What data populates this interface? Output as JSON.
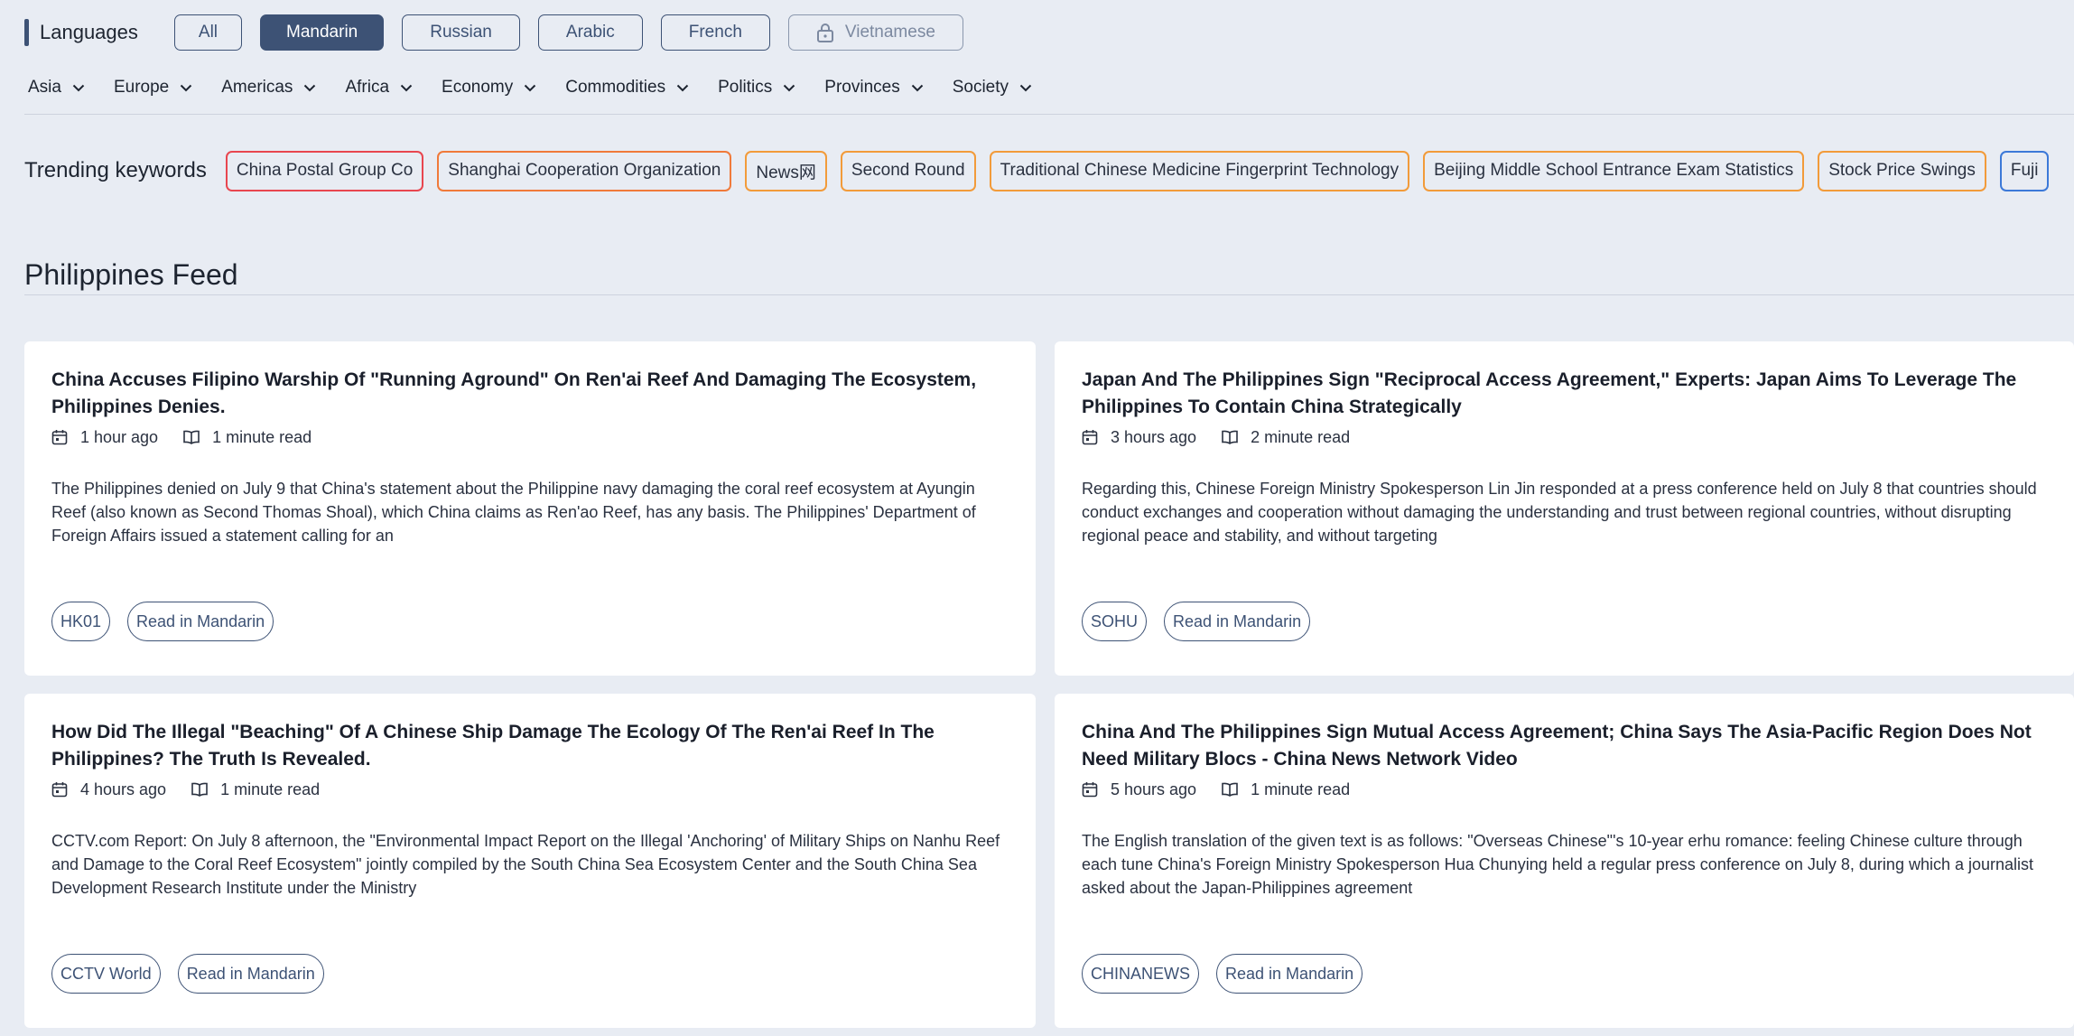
{
  "languages": {
    "title": "Languages",
    "options": [
      "All",
      "Mandarin",
      "Russian",
      "Arabic",
      "French",
      "Vietnamese"
    ],
    "active": "Mandarin",
    "locked": [
      "Vietnamese"
    ]
  },
  "nav": [
    "Asia",
    "Europe",
    "Americas",
    "Africa",
    "Economy",
    "Commodities",
    "Politics",
    "Provinces",
    "Society"
  ],
  "trending": {
    "title": "Trending keywords",
    "keywords": [
      {
        "label": "China Postal Group Co",
        "color": "#e8464f"
      },
      {
        "label": "Shanghai Cooperation Organization",
        "color": "#f07a3a"
      },
      {
        "label": "News网",
        "color": "#f29b3a"
      },
      {
        "label": "Second Round",
        "color": "#f29b3a"
      },
      {
        "label": "Traditional Chinese Medicine Fingerprint Technology",
        "color": "#f29b3a"
      },
      {
        "label": "Beijing Middle School Entrance Exam Statistics",
        "color": "#f29b3a"
      },
      {
        "label": "Stock Price Swings",
        "color": "#f29b3a"
      },
      {
        "label": "Fuji",
        "color": "#3c79d8"
      }
    ]
  },
  "feed": {
    "title": "Philippines Feed",
    "cards": [
      {
        "title": "China Accuses Filipino Warship Of \"Running Aground\" On Ren'ai Reef And Damaging The Ecosystem, Philippines Denies.",
        "time": "1 hour ago",
        "read": "1 minute read",
        "summary": "The Philippines denied on July 9 that China's statement about the Philippine navy damaging the coral reef ecosystem at Ayungin Reef (also known as Second Thomas Shoal), which China claims as Ren'ao Reef, has any basis. The Philippines' Department of Foreign Affairs issued a statement calling for an",
        "source": "HK01",
        "action": "Read in Mandarin"
      },
      {
        "title": "Japan And The Philippines Sign \"Reciprocal Access Agreement,\" Experts: Japan Aims To Leverage The Philippines To Contain China Strategically",
        "time": "3 hours ago",
        "read": "2 minute read",
        "summary": "Regarding this, Chinese Foreign Ministry Spokesperson Lin Jin responded at a press conference held on July 8 that countries should conduct exchanges and cooperation without damaging the understanding and trust between regional countries, without disrupting regional peace and stability, and without targeting",
        "source": "SOHU",
        "action": "Read in Mandarin"
      },
      {
        "title": "How Did The Illegal \"Beaching\" Of A Chinese Ship Damage The Ecology Of The Ren'ai Reef In The Philippines? The Truth Is Revealed.",
        "time": "4 hours ago",
        "read": "1 minute read",
        "summary": "CCTV.com Report: On July 8 afternoon, the \"Environmental Impact Report on the Illegal 'Anchoring' of Military Ships on Nanhu Reef and Damage to the Coral Reef Ecosystem\" jointly compiled by the South China Sea Ecosystem Center and the South China Sea Development Research Institute under the Ministry",
        "source": "CCTV World",
        "action": "Read in Mandarin"
      },
      {
        "title": "China And The Philippines Sign Mutual Access Agreement; China Says The Asia-Pacific Region Does Not Need Military Blocs - China News Network Video",
        "time": "5 hours ago",
        "read": "1 minute read",
        "summary": "The English translation of the given text is as follows: \"Overseas Chinese\"'s 10-year erhu romance: feeling Chinese culture through each tune China's Foreign Ministry Spokesperson Hua Chunying held a regular press conference on July 8, during which a journalist asked about the Japan-Philippines agreement",
        "source": "CHINANEWS",
        "action": "Read in Mandarin"
      }
    ]
  }
}
